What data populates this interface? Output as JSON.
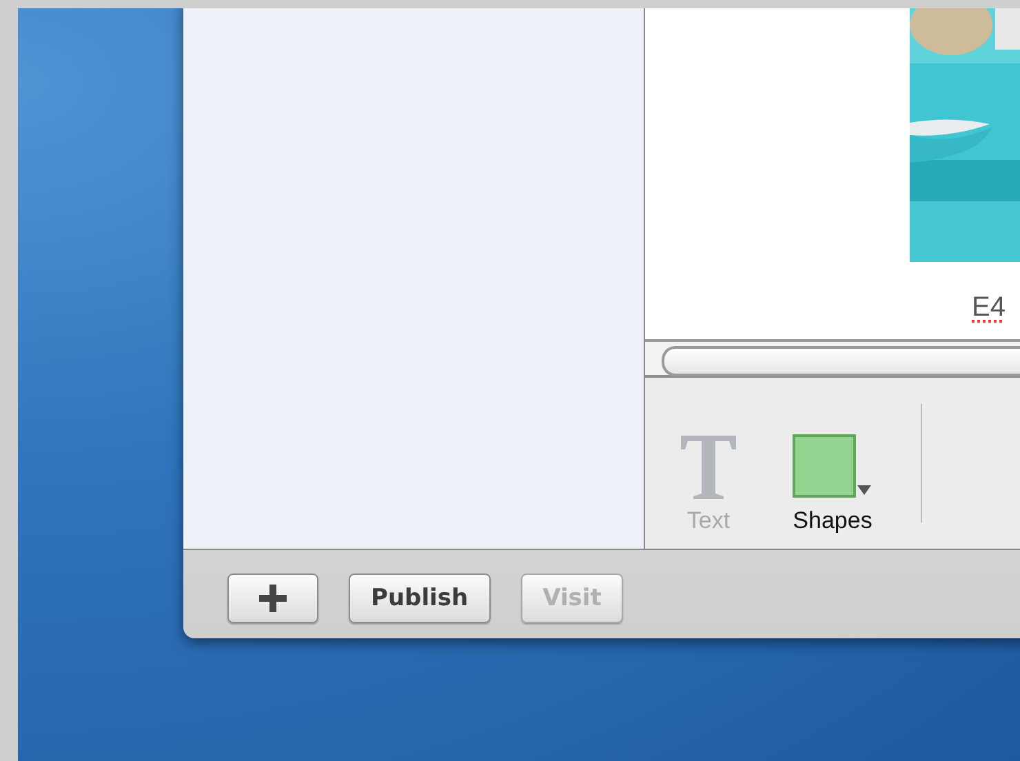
{
  "canvas": {
    "caption": "E4",
    "caption_misspelled": true
  },
  "toolbar": {
    "tools": [
      {
        "kind": "text",
        "label": "Text",
        "disabled": true
      },
      {
        "kind": "shapes",
        "label": "Shapes",
        "disabled": false
      }
    ]
  },
  "bottom_bar": {
    "buttons": [
      {
        "kind": "add",
        "disabled": false
      },
      {
        "kind": "label",
        "label": "Publish",
        "disabled": false
      },
      {
        "kind": "label",
        "label": "Visit",
        "disabled": true
      }
    ]
  }
}
